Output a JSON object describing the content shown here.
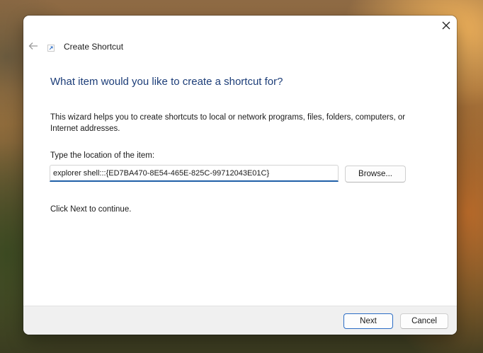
{
  "window": {
    "title": "Create Shortcut",
    "icons": {
      "close": "close-icon",
      "back": "back-arrow-icon",
      "app": "shortcut-icon"
    }
  },
  "wizard": {
    "heading": "What item would you like to create a shortcut for?",
    "description": "This wizard helps you to create shortcuts to local or network programs, files, folders, computers, or Internet addresses.",
    "location_label": "Type the location of the item:",
    "location_value": "explorer shell:::{ED7BA470-8E54-465E-825C-99712043E01C}",
    "browse_label": "Browse...",
    "continue_text": "Click Next to continue."
  },
  "footer": {
    "next_label": "Next",
    "cancel_label": "Cancel"
  },
  "colors": {
    "heading": "#1c3d78",
    "accent": "#1f5fa8",
    "footer_bg": "#f0f0f0"
  }
}
